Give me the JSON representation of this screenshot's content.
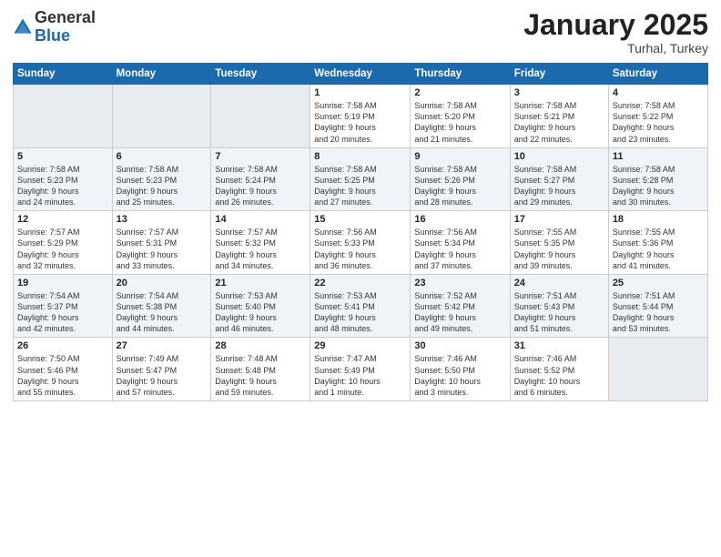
{
  "logo": {
    "general": "General",
    "blue": "Blue"
  },
  "header": {
    "month": "January 2025",
    "location": "Turhal, Turkey"
  },
  "weekdays": [
    "Sunday",
    "Monday",
    "Tuesday",
    "Wednesday",
    "Thursday",
    "Friday",
    "Saturday"
  ],
  "weeks": [
    [
      {
        "day": "",
        "info": ""
      },
      {
        "day": "",
        "info": ""
      },
      {
        "day": "",
        "info": ""
      },
      {
        "day": "1",
        "info": "Sunrise: 7:58 AM\nSunset: 5:19 PM\nDaylight: 9 hours\nand 20 minutes."
      },
      {
        "day": "2",
        "info": "Sunrise: 7:58 AM\nSunset: 5:20 PM\nDaylight: 9 hours\nand 21 minutes."
      },
      {
        "day": "3",
        "info": "Sunrise: 7:58 AM\nSunset: 5:21 PM\nDaylight: 9 hours\nand 22 minutes."
      },
      {
        "day": "4",
        "info": "Sunrise: 7:58 AM\nSunset: 5:22 PM\nDaylight: 9 hours\nand 23 minutes."
      }
    ],
    [
      {
        "day": "5",
        "info": "Sunrise: 7:58 AM\nSunset: 5:23 PM\nDaylight: 9 hours\nand 24 minutes."
      },
      {
        "day": "6",
        "info": "Sunrise: 7:58 AM\nSunset: 5:23 PM\nDaylight: 9 hours\nand 25 minutes."
      },
      {
        "day": "7",
        "info": "Sunrise: 7:58 AM\nSunset: 5:24 PM\nDaylight: 9 hours\nand 26 minutes."
      },
      {
        "day": "8",
        "info": "Sunrise: 7:58 AM\nSunset: 5:25 PM\nDaylight: 9 hours\nand 27 minutes."
      },
      {
        "day": "9",
        "info": "Sunrise: 7:58 AM\nSunset: 5:26 PM\nDaylight: 9 hours\nand 28 minutes."
      },
      {
        "day": "10",
        "info": "Sunrise: 7:58 AM\nSunset: 5:27 PM\nDaylight: 9 hours\nand 29 minutes."
      },
      {
        "day": "11",
        "info": "Sunrise: 7:58 AM\nSunset: 5:28 PM\nDaylight: 9 hours\nand 30 minutes."
      }
    ],
    [
      {
        "day": "12",
        "info": "Sunrise: 7:57 AM\nSunset: 5:29 PM\nDaylight: 9 hours\nand 32 minutes."
      },
      {
        "day": "13",
        "info": "Sunrise: 7:57 AM\nSunset: 5:31 PM\nDaylight: 9 hours\nand 33 minutes."
      },
      {
        "day": "14",
        "info": "Sunrise: 7:57 AM\nSunset: 5:32 PM\nDaylight: 9 hours\nand 34 minutes."
      },
      {
        "day": "15",
        "info": "Sunrise: 7:56 AM\nSunset: 5:33 PM\nDaylight: 9 hours\nand 36 minutes."
      },
      {
        "day": "16",
        "info": "Sunrise: 7:56 AM\nSunset: 5:34 PM\nDaylight: 9 hours\nand 37 minutes."
      },
      {
        "day": "17",
        "info": "Sunrise: 7:55 AM\nSunset: 5:35 PM\nDaylight: 9 hours\nand 39 minutes."
      },
      {
        "day": "18",
        "info": "Sunrise: 7:55 AM\nSunset: 5:36 PM\nDaylight: 9 hours\nand 41 minutes."
      }
    ],
    [
      {
        "day": "19",
        "info": "Sunrise: 7:54 AM\nSunset: 5:37 PM\nDaylight: 9 hours\nand 42 minutes."
      },
      {
        "day": "20",
        "info": "Sunrise: 7:54 AM\nSunset: 5:38 PM\nDaylight: 9 hours\nand 44 minutes."
      },
      {
        "day": "21",
        "info": "Sunrise: 7:53 AM\nSunset: 5:40 PM\nDaylight: 9 hours\nand 46 minutes."
      },
      {
        "day": "22",
        "info": "Sunrise: 7:53 AM\nSunset: 5:41 PM\nDaylight: 9 hours\nand 48 minutes."
      },
      {
        "day": "23",
        "info": "Sunrise: 7:52 AM\nSunset: 5:42 PM\nDaylight: 9 hours\nand 49 minutes."
      },
      {
        "day": "24",
        "info": "Sunrise: 7:51 AM\nSunset: 5:43 PM\nDaylight: 9 hours\nand 51 minutes."
      },
      {
        "day": "25",
        "info": "Sunrise: 7:51 AM\nSunset: 5:44 PM\nDaylight: 9 hours\nand 53 minutes."
      }
    ],
    [
      {
        "day": "26",
        "info": "Sunrise: 7:50 AM\nSunset: 5:46 PM\nDaylight: 9 hours\nand 55 minutes."
      },
      {
        "day": "27",
        "info": "Sunrise: 7:49 AM\nSunset: 5:47 PM\nDaylight: 9 hours\nand 57 minutes."
      },
      {
        "day": "28",
        "info": "Sunrise: 7:48 AM\nSunset: 5:48 PM\nDaylight: 9 hours\nand 59 minutes."
      },
      {
        "day": "29",
        "info": "Sunrise: 7:47 AM\nSunset: 5:49 PM\nDaylight: 10 hours\nand 1 minute."
      },
      {
        "day": "30",
        "info": "Sunrise: 7:46 AM\nSunset: 5:50 PM\nDaylight: 10 hours\nand 3 minutes."
      },
      {
        "day": "31",
        "info": "Sunrise: 7:46 AM\nSunset: 5:52 PM\nDaylight: 10 hours\nand 6 minutes."
      },
      {
        "day": "",
        "info": ""
      }
    ]
  ]
}
